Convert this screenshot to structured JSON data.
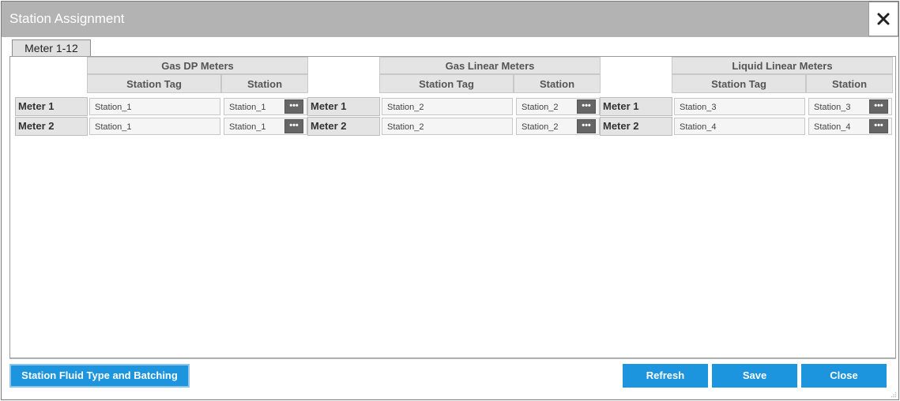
{
  "window": {
    "title": "Station Assignment"
  },
  "tabs": [
    {
      "label": "Meter 1-12"
    }
  ],
  "groups": [
    {
      "title": "Gas DP Meters",
      "col_tag": "Station Tag",
      "col_station": "Station",
      "rows": [
        {
          "label": "Meter 1",
          "tag": "Station_1",
          "station": "Station_1"
        },
        {
          "label": "Meter 2",
          "tag": "Station_1",
          "station": "Station_1"
        }
      ]
    },
    {
      "title": "Gas Linear Meters",
      "col_tag": "Station Tag",
      "col_station": "Station",
      "rows": [
        {
          "label": "Meter 1",
          "tag": "Station_2",
          "station": "Station_2"
        },
        {
          "label": "Meter 2",
          "tag": "Station_2",
          "station": "Station_2"
        }
      ]
    },
    {
      "title": "Liquid Linear Meters",
      "col_tag": "Station Tag",
      "col_station": "Station",
      "rows": [
        {
          "label": "Meter 1",
          "tag": "Station_3",
          "station": "Station_3"
        },
        {
          "label": "Meter 2",
          "tag": "Station_4",
          "station": "Station_4"
        }
      ]
    }
  ],
  "picker_label": "•••",
  "footer": {
    "fluid_button": "Station Fluid Type and Batching",
    "refresh": "Refresh",
    "save": "Save",
    "close": "Close"
  },
  "colors": {
    "accent": "#1d94de",
    "titlebar": "#b3b3b3",
    "picker": "#666666"
  }
}
